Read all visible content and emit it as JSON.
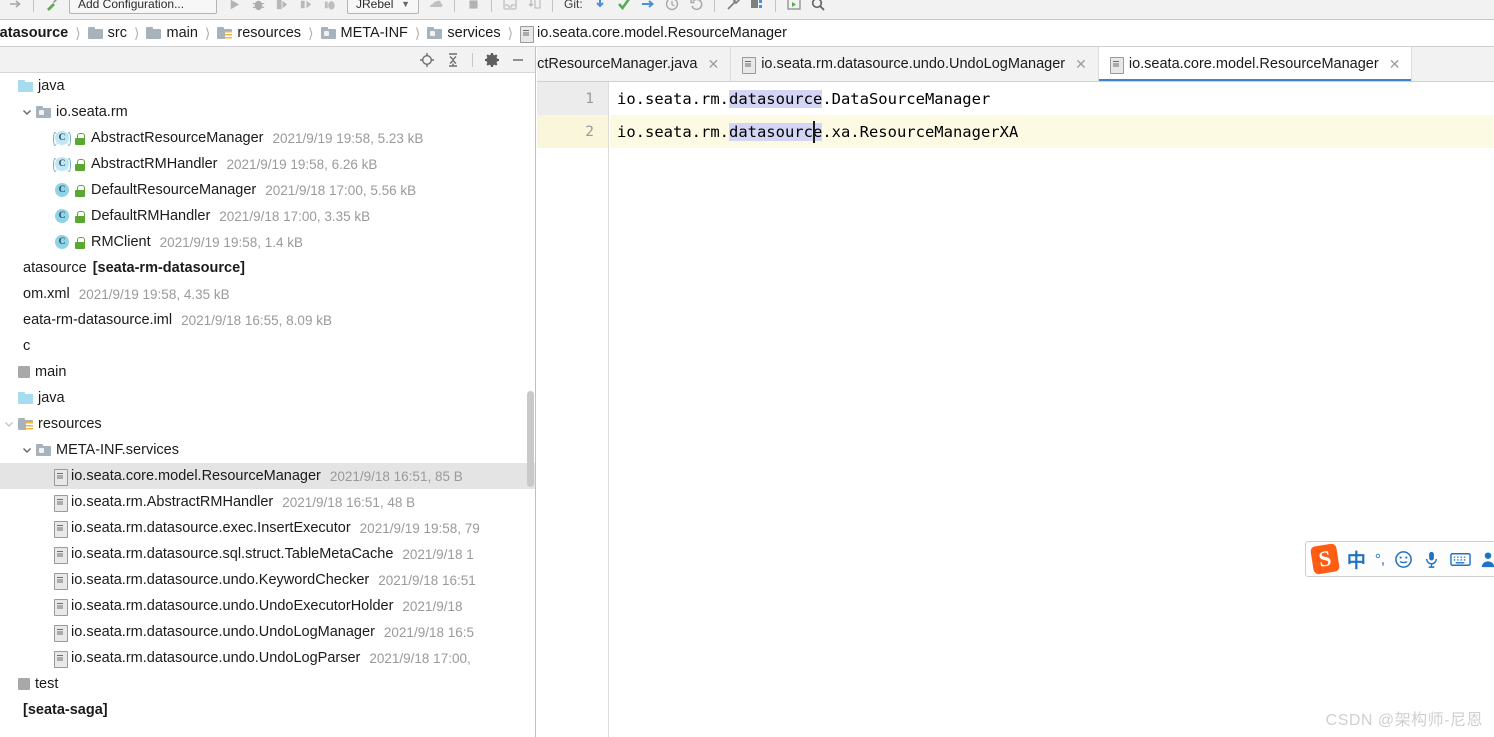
{
  "toolbar": {
    "icons": [
      "forward-arrow-icon",
      "build-icon"
    ],
    "run_config_label": "Add Configuration...",
    "run_icons": [
      "run-icon",
      "debug-icon",
      "run-coverage-icon",
      "profile-icon",
      "debug-attach-icon"
    ],
    "jrebel_label": "JRebel",
    "git_label": "Git:",
    "right_icons": [
      "update-project-icon",
      "commit-icon",
      "push-icon",
      "history-icon",
      "rollback-icon",
      "wrench-icon",
      "plugins-icon",
      "run-anything-icon",
      "search-everywhere-icon"
    ]
  },
  "breadcrumb": {
    "items": [
      {
        "label": "-datasource",
        "icon": "none",
        "bold": true
      },
      {
        "label": "src",
        "icon": "folder-icon",
        "bold": false
      },
      {
        "label": "main",
        "icon": "folder-icon",
        "bold": false
      },
      {
        "label": "resources",
        "icon": "resources-folder-icon",
        "bold": false
      },
      {
        "label": "META-INF",
        "icon": "package-folder-icon",
        "bold": false
      },
      {
        "label": "services",
        "icon": "package-folder-icon",
        "bold": false
      },
      {
        "label": "io.seata.core.model.ResourceManager",
        "icon": "text-file-icon",
        "bold": false
      }
    ],
    "separator": "〉"
  },
  "project_panel": {
    "toolbar_buttons": [
      "locate-target-icon",
      "collapse-all-icon",
      "settings-gear-icon",
      "minimize-icon"
    ],
    "tree": [
      {
        "indent": 0,
        "twisty": "none",
        "icon": "folder-blue-icon",
        "name": "java",
        "meta": "",
        "bold": false,
        "selected": false
      },
      {
        "indent": 1,
        "twisty": "open",
        "icon": "package-folder-icon",
        "name": "io.seata.rm",
        "meta": "",
        "bold": false,
        "selected": false
      },
      {
        "indent": 2,
        "twisty": "none",
        "icon": "abstract-class-icon",
        "name": "AbstractResourceManager",
        "meta": "2021/9/19 19:58, 5.23 kB",
        "bold": false,
        "selected": false
      },
      {
        "indent": 2,
        "twisty": "none",
        "icon": "abstract-class-icon",
        "name": "AbstractRMHandler",
        "meta": "2021/9/19 19:58, 6.26 kB",
        "bold": false,
        "selected": false
      },
      {
        "indent": 2,
        "twisty": "none",
        "icon": "class-icon",
        "name": "DefaultResourceManager",
        "meta": "2021/9/18 17:00, 5.56 kB",
        "bold": false,
        "selected": false
      },
      {
        "indent": 2,
        "twisty": "none",
        "icon": "class-icon",
        "name": "DefaultRMHandler",
        "meta": "2021/9/18 17:00, 3.35 kB",
        "bold": false,
        "selected": false
      },
      {
        "indent": 2,
        "twisty": "none",
        "icon": "class-icon",
        "name": "RMClient",
        "meta": "2021/9/19 19:58, 1.4 kB",
        "bold": false,
        "selected": false
      },
      {
        "indent": -1,
        "twisty": "none",
        "icon": "none",
        "name": "atasource",
        "meta": "",
        "suffix": "[seata-rm-datasource]",
        "bold": false,
        "selected": false
      },
      {
        "indent": -1,
        "twisty": "none",
        "icon": "none",
        "name": "om.xml",
        "meta": "2021/9/19 19:58, 4.35 kB",
        "bold": false,
        "selected": false
      },
      {
        "indent": -1,
        "twisty": "none",
        "icon": "none",
        "name": "eata-rm-datasource.iml",
        "meta": "2021/9/18 16:55, 8.09 kB",
        "bold": false,
        "selected": false
      },
      {
        "indent": -1,
        "twisty": "none",
        "icon": "none",
        "name": "c",
        "meta": "",
        "bold": false,
        "selected": false
      },
      {
        "indent": -1,
        "twisty": "none",
        "icon": "module-icon",
        "name": "main",
        "meta": "",
        "bold": false,
        "selected": false
      },
      {
        "indent": 0,
        "twisty": "none",
        "icon": "folder-blue-icon",
        "name": "java",
        "meta": "",
        "bold": false,
        "selected": false
      },
      {
        "indent": 0,
        "twisty": "openfaint",
        "icon": "resources-folder-icon",
        "name": "resources",
        "meta": "",
        "bold": false,
        "selected": false
      },
      {
        "indent": 1,
        "twisty": "open",
        "icon": "package-folder-icon",
        "name": "META-INF.services",
        "meta": "",
        "bold": false,
        "selected": false
      },
      {
        "indent": 2,
        "twisty": "none",
        "icon": "text-file-icon",
        "name": "io.seata.core.model.ResourceManager",
        "meta": "2021/9/18 16:51, 85 B",
        "bold": false,
        "selected": true
      },
      {
        "indent": 2,
        "twisty": "none",
        "icon": "text-file-icon",
        "name": "io.seata.rm.AbstractRMHandler",
        "meta": "2021/9/18 16:51, 48 B",
        "bold": false,
        "selected": false
      },
      {
        "indent": 2,
        "twisty": "none",
        "icon": "text-file-icon",
        "name": "io.seata.rm.datasource.exec.InsertExecutor",
        "meta": "2021/9/19 19:58, 79",
        "bold": false,
        "selected": false
      },
      {
        "indent": 2,
        "twisty": "none",
        "icon": "text-file-icon",
        "name": "io.seata.rm.datasource.sql.struct.TableMetaCache",
        "meta": "2021/9/18 1",
        "bold": false,
        "selected": false
      },
      {
        "indent": 2,
        "twisty": "none",
        "icon": "text-file-icon",
        "name": "io.seata.rm.datasource.undo.KeywordChecker",
        "meta": "2021/9/18 16:51",
        "bold": false,
        "selected": false
      },
      {
        "indent": 2,
        "twisty": "none",
        "icon": "text-file-icon",
        "name": "io.seata.rm.datasource.undo.UndoExecutorHolder",
        "meta": "2021/9/18",
        "bold": false,
        "selected": false
      },
      {
        "indent": 2,
        "twisty": "none",
        "icon": "text-file-icon",
        "name": "io.seata.rm.datasource.undo.UndoLogManager",
        "meta": "2021/9/18 16:5",
        "bold": false,
        "selected": false
      },
      {
        "indent": 2,
        "twisty": "none",
        "icon": "text-file-icon",
        "name": "io.seata.rm.datasource.undo.UndoLogParser",
        "meta": "2021/9/18 17:00,",
        "bold": false,
        "selected": false
      },
      {
        "indent": -1,
        "twisty": "none",
        "icon": "module-icon",
        "name": "test",
        "meta": "",
        "bold": false,
        "selected": false
      },
      {
        "indent": -1,
        "twisty": "none",
        "icon": "none",
        "name": "[seata-saga]",
        "meta": "",
        "bold": true,
        "selected": false
      }
    ]
  },
  "editor": {
    "tabs": [
      {
        "label": "actResourceManager.java",
        "icon": "none",
        "active": false,
        "close": "✕"
      },
      {
        "label": "io.seata.rm.datasource.undo.UndoLogManager",
        "icon": "text-file-icon",
        "active": false,
        "close": "✕"
      },
      {
        "label": "io.seata.core.model.ResourceManager",
        "icon": "text-file-icon",
        "active": true,
        "close": "✕"
      }
    ],
    "lines": [
      {
        "number": "1",
        "prefix": "io.seata.rm.",
        "selected": "datasource",
        "suffix": ".DataSourceManager",
        "current": false
      },
      {
        "number": "2",
        "prefix": "io.seata.rm.",
        "selected": "datasource",
        "suffix": ".xa.ResourceManagerXA",
        "current": true
      }
    ],
    "caret_after": "datasourc"
  },
  "ime": {
    "logo": "S",
    "mode_label": "中",
    "punct_label": "°,",
    "icons": [
      "emoji-icon",
      "voice-input-icon",
      "soft-keyboard-icon",
      "user-icon"
    ]
  },
  "watermark": {
    "text": "CSDN @架构师-尼恩"
  },
  "colors": {
    "selection": "#d4d4f4",
    "current_line": "#fdfae4",
    "tab_underline": "#4083c9",
    "tree_selection": "#e4e4e4"
  }
}
